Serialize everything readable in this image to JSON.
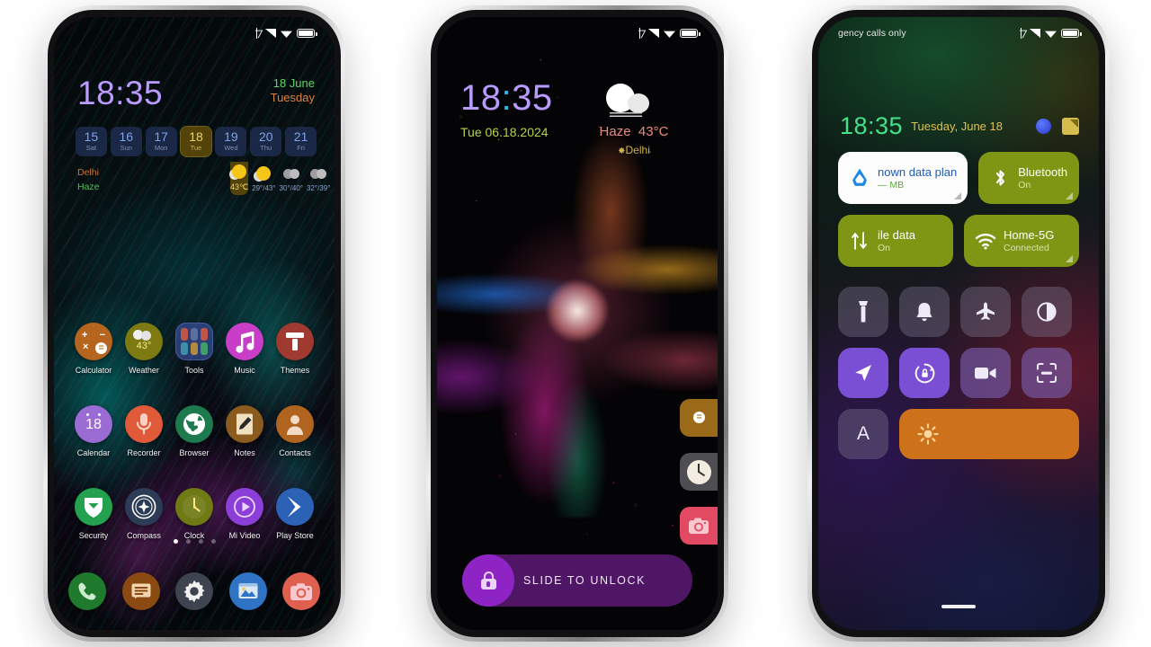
{
  "meta": {
    "background_color": "#ffffff",
    "phone_count": 3
  },
  "phone1": {
    "name": "home-screen",
    "statusbar": {
      "left_text": "",
      "icons": [
        "bluetooth-icon",
        "signal-icon",
        "wifi-icon",
        "battery-icon"
      ]
    },
    "clock": {
      "time": "18:35",
      "date_line1": "18 June",
      "date_line2": "Tuesday"
    },
    "week": [
      {
        "num": "15",
        "label": "Sat",
        "selected": false
      },
      {
        "num": "16",
        "label": "Sun",
        "selected": false
      },
      {
        "num": "17",
        "label": "Mon",
        "selected": false
      },
      {
        "num": "18",
        "label": "Tue",
        "selected": true
      },
      {
        "num": "19",
        "label": "Wed",
        "selected": false
      },
      {
        "num": "20",
        "label": "Thu",
        "selected": false
      },
      {
        "num": "21",
        "label": "Fri",
        "selected": false
      }
    ],
    "weather": {
      "city": "Delhi",
      "condition": "Haze",
      "forecast": [
        {
          "glyph": "sunny",
          "temps": "43℃",
          "selected": true
        },
        {
          "glyph": "sunny",
          "temps": "29°/43°",
          "selected": false
        },
        {
          "glyph": "cloudy",
          "temps": "30°/40°",
          "selected": false
        },
        {
          "glyph": "cloudy",
          "temps": "32°/39°",
          "selected": false
        }
      ]
    },
    "apps_row1": [
      {
        "label": "Calculator",
        "icon": "calculator-icon",
        "color": "#b5651d"
      },
      {
        "label": "Weather",
        "icon": "weather-icon",
        "color": "#7d7a12",
        "badge": "43°"
      },
      {
        "label": "Tools",
        "icon": "folder-icon",
        "color": "#4a5fbe"
      },
      {
        "label": "Music",
        "icon": "music-note-icon",
        "color": "#c83ec8"
      },
      {
        "label": "Themes",
        "icon": "themes-icon",
        "color": "#a0392f"
      }
    ],
    "apps_row2": [
      {
        "label": "Calendar",
        "icon": "calendar-icon",
        "color": "#9b6bd4",
        "badge": "18"
      },
      {
        "label": "Recorder",
        "icon": "mic-icon",
        "color": "#e05a3a"
      },
      {
        "label": "Browser",
        "icon": "globe-icon",
        "color": "#1d7a4e"
      },
      {
        "label": "Notes",
        "icon": "notes-icon",
        "color": "#8a5a1e"
      },
      {
        "label": "Contacts",
        "icon": "contacts-icon",
        "color": "#b0641f"
      }
    ],
    "apps_row3": [
      {
        "label": "Security",
        "icon": "shield-icon",
        "color": "#23a14f"
      },
      {
        "label": "Compass",
        "icon": "compass-icon",
        "color": "#2c3b56"
      },
      {
        "label": "Clock",
        "icon": "clock-icon",
        "color": "#6f7a14"
      },
      {
        "label": "Mi Video",
        "icon": "play-icon",
        "color": "#8b3fd8"
      },
      {
        "label": "Play Store",
        "icon": "playstore-icon",
        "color": "#2b62b5"
      }
    ],
    "dock": [
      {
        "label": "Phone",
        "icon": "phone-icon",
        "color": "#1f7a2e"
      },
      {
        "label": "Messages",
        "icon": "message-icon",
        "color": "#8a4a12"
      },
      {
        "label": "Settings",
        "icon": "gear-icon",
        "color": "#3d4450"
      },
      {
        "label": "Gallery",
        "icon": "gallery-icon",
        "color": "#2f74c4"
      },
      {
        "label": "Camera",
        "icon": "camera-icon",
        "color": "#e0604f"
      }
    ],
    "page_dots": {
      "count": 4,
      "active_index": 0
    }
  },
  "phone2": {
    "name": "lock-screen",
    "statusbar": {
      "left_text": "",
      "icons": [
        "bluetooth-icon",
        "signal-icon",
        "wifi-icon",
        "battery-icon"
      ]
    },
    "clock": {
      "time_hours": "18",
      "colon": ":",
      "time_minutes": "35",
      "date": "Tue 06.18.2024"
    },
    "weather": {
      "icon": "haze-cloud-icon",
      "condition": "Haze",
      "temperature": "43°C",
      "city": "Delhi"
    },
    "shortcuts": [
      {
        "name": "calculator-shortcut",
        "icon": "calculator-icon",
        "color": "#9a6a18"
      },
      {
        "name": "clock-shortcut",
        "icon": "clock-icon",
        "color": "#4d4d52"
      },
      {
        "name": "camera-shortcut",
        "icon": "camera-icon",
        "color": "#e24a63"
      }
    ],
    "unlock": {
      "label": "SLIDE TO UNLOCK",
      "icon": "lock-icon",
      "accent": "#8e24c4"
    }
  },
  "phone3": {
    "name": "control-center",
    "statusbar": {
      "left_text": "gency calls only",
      "icons": [
        "bluetooth-icon",
        "signal-icon",
        "wifi-icon",
        "battery-icon"
      ]
    },
    "clock": {
      "time": "18:35",
      "date": "Tuesday, June 18"
    },
    "header_actions": [
      {
        "name": "user-dot",
        "icon": "user-dot-icon"
      },
      {
        "name": "edit-button",
        "icon": "edit-icon"
      }
    ],
    "big_tiles": [
      {
        "title": "nown data plan",
        "subtitle": "— MB",
        "icon": "data-drop-icon",
        "style": "white"
      },
      {
        "title": "Bluetooth",
        "subtitle": "On",
        "icon": "bluetooth-icon",
        "style": "green"
      },
      {
        "title": "ile data",
        "subtitle": "On",
        "icon": "mobile-data-icon",
        "style": "green"
      },
      {
        "title": "Home-5G",
        "subtitle": "Connected",
        "icon": "wifi-icon",
        "style": "green"
      }
    ],
    "toggles_row1": [
      {
        "name": "flashlight-toggle",
        "icon": "flashlight-icon",
        "state": "off"
      },
      {
        "name": "ringer-toggle",
        "icon": "bell-icon",
        "state": "off"
      },
      {
        "name": "airplane-toggle",
        "icon": "airplane-icon",
        "state": "off"
      },
      {
        "name": "dark-mode-toggle",
        "icon": "contrast-icon",
        "state": "off"
      }
    ],
    "toggles_row2": [
      {
        "name": "location-toggle",
        "icon": "location-arrow-icon",
        "state": "on"
      },
      {
        "name": "rotation-toggle",
        "icon": "rotation-lock-icon",
        "state": "on"
      },
      {
        "name": "screen-record-toggle",
        "icon": "video-camera-icon",
        "state": "off"
      },
      {
        "name": "screenshot-toggle",
        "icon": "scan-frame-icon",
        "state": "off"
      }
    ],
    "toggles_row3": [
      {
        "name": "auto-brightness-toggle",
        "icon": "letter-a-icon",
        "label": "A",
        "state": "off"
      }
    ],
    "brightness": {
      "name": "brightness-slider",
      "icon": "sun-icon",
      "level_percent": 100,
      "color": "#cd711a"
    },
    "home_handle": true
  }
}
